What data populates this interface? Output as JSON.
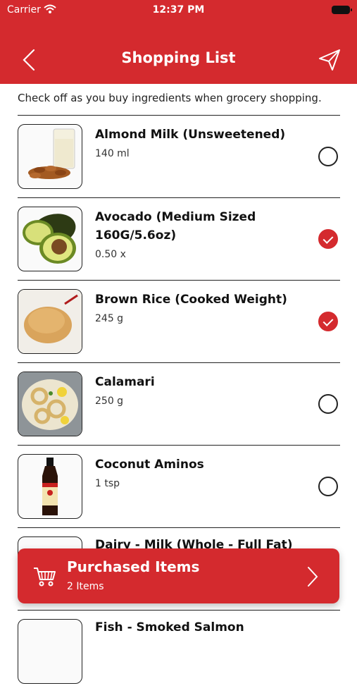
{
  "status_bar": {
    "carrier": "Carrier",
    "time": "12:37 PM"
  },
  "header": {
    "title": "Shopping List"
  },
  "intro_text": "Check off as you buy ingredients when grocery shopping.",
  "items": [
    {
      "name": "Almond Milk (Unsweetened)",
      "quantity": "140 ml",
      "checked": false,
      "image": "almond-milk"
    },
    {
      "name": "Avocado (Medium Sized 160G/5.6oz)",
      "quantity": "0.50 x",
      "checked": true,
      "image": "avocado"
    },
    {
      "name": "Brown Rice (Cooked Weight)",
      "quantity": "245 g",
      "checked": true,
      "image": "brown-rice"
    },
    {
      "name": "Calamari",
      "quantity": "250 g",
      "checked": false,
      "image": "calamari"
    },
    {
      "name": "Coconut Aminos",
      "quantity": "1 tsp",
      "checked": false,
      "image": "coconut-aminos"
    }
  ],
  "partial_items": [
    {
      "name": "Dairy - Milk (Whole - Full Fat)"
    },
    {
      "name": "Fish - Smoked Salmon"
    }
  ],
  "purchased": {
    "title": "Purchased Items",
    "count_label": "2 Items"
  },
  "colors": {
    "accent": "#d42a2e"
  }
}
